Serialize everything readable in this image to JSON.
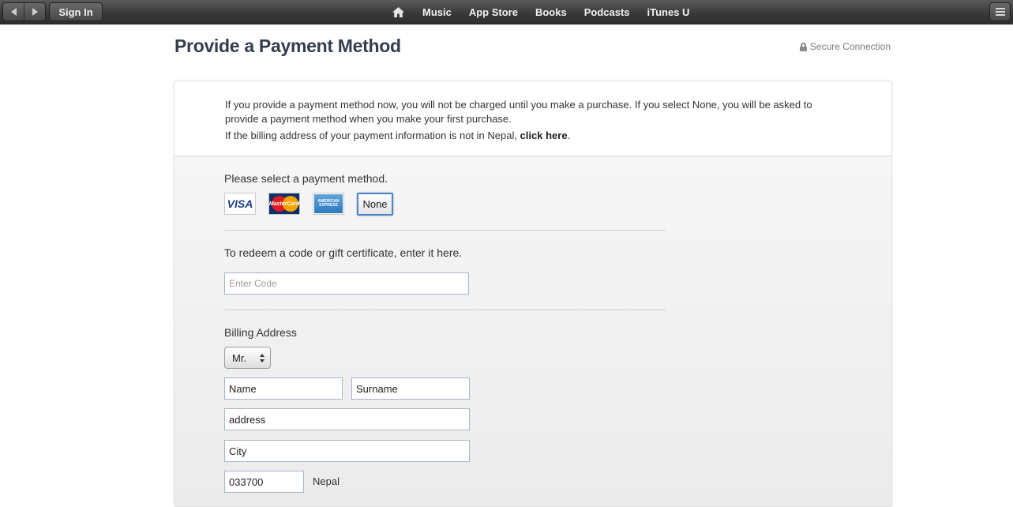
{
  "toolbar": {
    "sign_in_label": "Sign In",
    "nav_items": [
      "Music",
      "App Store",
      "Books",
      "Podcasts",
      "iTunes U"
    ],
    "icons": [
      "back-icon",
      "forward-icon",
      "home-icon",
      "menu-icon"
    ]
  },
  "page": {
    "title": "Provide a Payment Method",
    "secure_label": "Secure Connection"
  },
  "intro": {
    "line1": "If you provide a payment method now, you will not be charged until you make a purchase. If you select None, you will be asked to provide a payment method when you make your first purchase.",
    "line2_prefix": "If the billing address of your payment information is not in Nepal, ",
    "line2_link": "click here",
    "line2_suffix": "."
  },
  "payment": {
    "label": "Please select a payment method.",
    "options": {
      "visa": "VISA",
      "mastercard": "MasterCard",
      "amex": "AMERICAN EXPRESS",
      "none": "None"
    },
    "selected": "None"
  },
  "redeem": {
    "label": "To redeem a code or gift certificate, enter it here.",
    "placeholder": "Enter Code"
  },
  "billing": {
    "label": "Billing Address",
    "title_value": "Mr.",
    "first_name": "Name",
    "last_name": "Surname",
    "address": "address",
    "city": "City",
    "postal_code": "033700",
    "country": "Nepal"
  },
  "colors": {
    "toolbar": "#3a3a3a",
    "title": "#333d4d",
    "selected_border": "#4f83c6",
    "field_border": "#a7b5c8"
  }
}
